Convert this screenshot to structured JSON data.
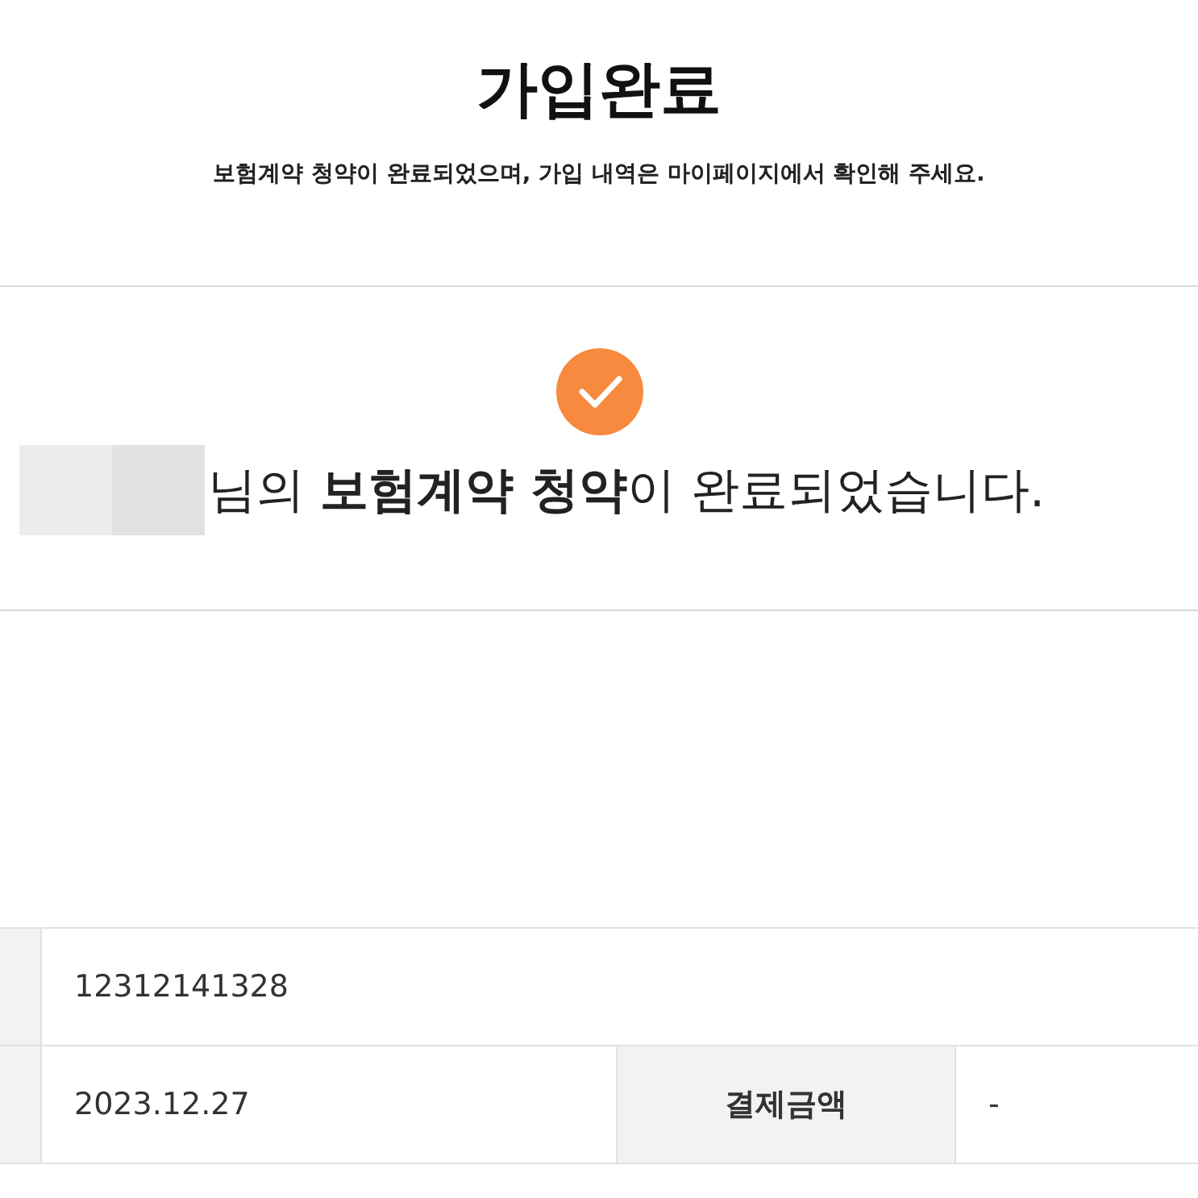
{
  "header": {
    "title": "가입완료",
    "subtitle": "보험계약 청약이 완료되었으며, 가입 내역은 마이페이지에서 확인해 주세요."
  },
  "result": {
    "name_redacted": true,
    "message": "님의 **보험계약 청약**이 완료되었습니다."
  },
  "table": {
    "rows": [
      {
        "cells": [
          {
            "kind": "label"
          },
          {
            "kind": "value",
            "text": "12312141328"
          }
        ]
      },
      {
        "cells": [
          {
            "kind": "label"
          },
          {
            "kind": "value",
            "text": "2023.12.27"
          },
          {
            "kind": "label",
            "text": "결제금액"
          },
          {
            "kind": "value",
            "text": "-"
          }
        ]
      }
    ]
  }
}
